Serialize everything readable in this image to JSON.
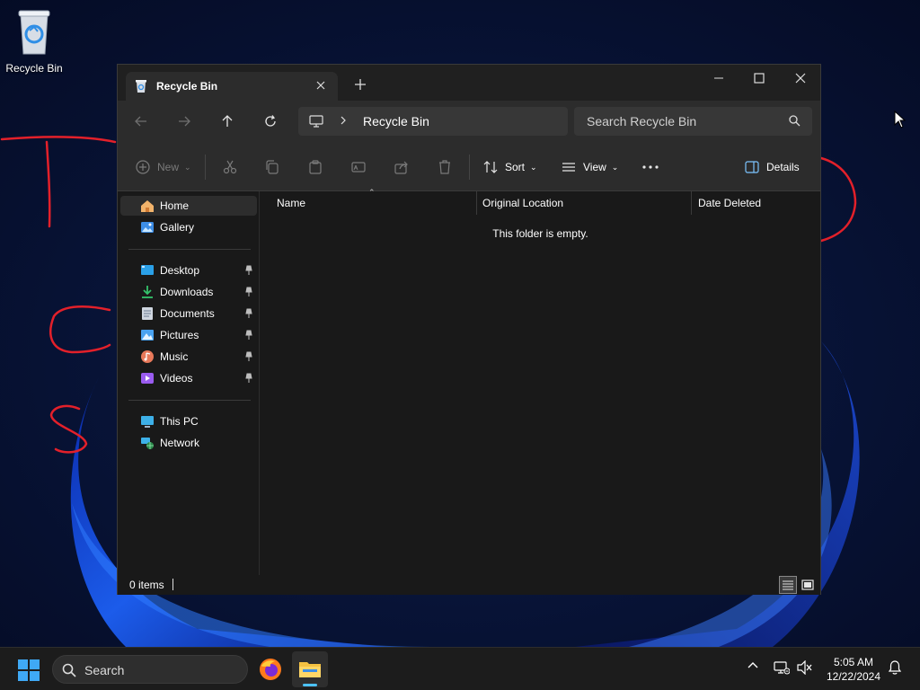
{
  "desktop": {
    "icons": [
      {
        "label": "Recycle Bin"
      }
    ]
  },
  "window": {
    "tab": {
      "title": "Recycle Bin"
    },
    "controls": {
      "minimize": "minimize",
      "maximize": "maximize",
      "close": "close"
    },
    "address": {
      "crumbs": [
        "Recycle Bin"
      ]
    },
    "search": {
      "placeholder": "Search Recycle Bin"
    },
    "toolbar": {
      "new_label": "New",
      "sort_label": "Sort",
      "view_label": "View",
      "details_label": "Details"
    },
    "sidebar": {
      "top": [
        {
          "label": "Home",
          "icon": "home-icon",
          "selected": true
        },
        {
          "label": "Gallery",
          "icon": "gallery-icon"
        }
      ],
      "pinned": [
        {
          "label": "Desktop",
          "icon": "desktop-icon"
        },
        {
          "label": "Downloads",
          "icon": "downloads-icon"
        },
        {
          "label": "Documents",
          "icon": "documents-icon"
        },
        {
          "label": "Pictures",
          "icon": "pictures-icon"
        },
        {
          "label": "Music",
          "icon": "music-icon"
        },
        {
          "label": "Videos",
          "icon": "videos-icon"
        }
      ],
      "bottom": [
        {
          "label": "This PC",
          "icon": "this-pc-icon"
        },
        {
          "label": "Network",
          "icon": "network-icon"
        }
      ]
    },
    "columns": [
      "Name",
      "Original Location",
      "Date Deleted"
    ],
    "empty_message": "This folder is empty.",
    "status": {
      "item_count": "0 items"
    }
  },
  "taskbar": {
    "search_label": "Search",
    "clock": {
      "time": "5:05 AM",
      "date": "12/22/2024"
    }
  },
  "colors": {
    "accent": "#4cc2ff",
    "window_bg": "#191919",
    "toolbar_bg": "#2c2c2c",
    "annotation_red": "#e3202a"
  }
}
